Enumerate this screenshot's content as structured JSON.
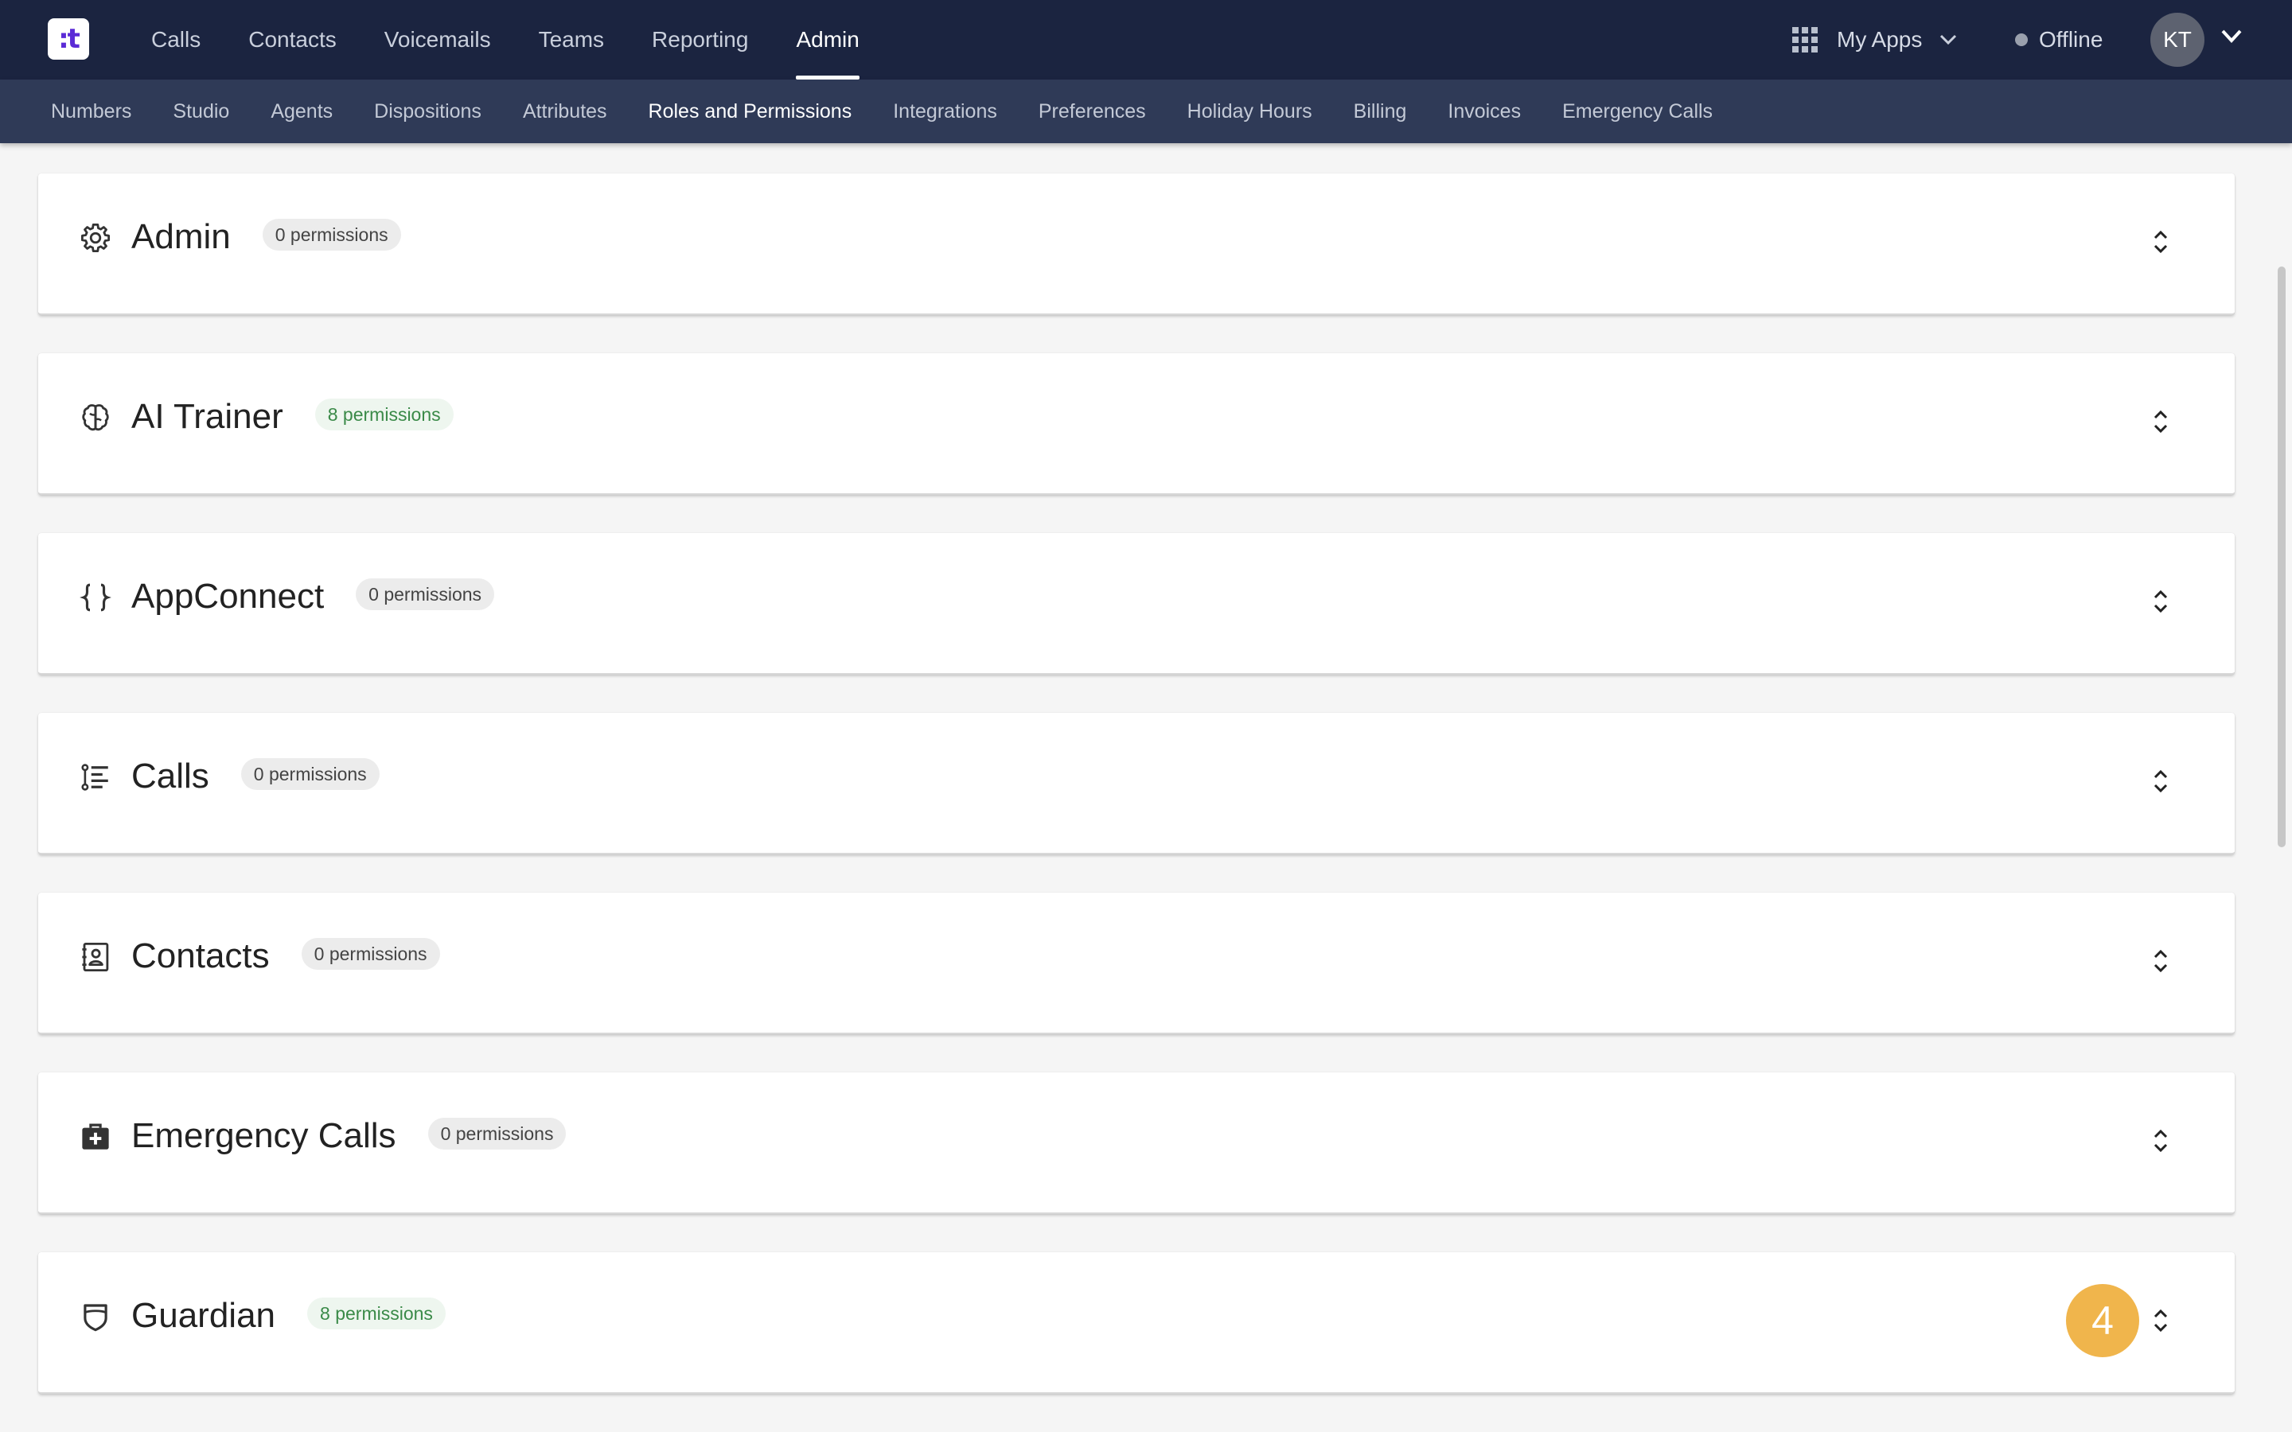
{
  "app": {
    "logo_text": ":t"
  },
  "topnav": {
    "items": [
      {
        "label": "Calls"
      },
      {
        "label": "Contacts"
      },
      {
        "label": "Voicemails"
      },
      {
        "label": "Teams"
      },
      {
        "label": "Reporting"
      },
      {
        "label": "Admin",
        "active": true
      }
    ],
    "my_apps_label": "My Apps",
    "status_label": "Offline",
    "avatar_initials": "KT"
  },
  "subnav": {
    "items": [
      {
        "label": "Numbers"
      },
      {
        "label": "Studio"
      },
      {
        "label": "Agents"
      },
      {
        "label": "Dispositions"
      },
      {
        "label": "Attributes"
      },
      {
        "label": "Roles and Permissions",
        "active": true
      },
      {
        "label": "Integrations"
      },
      {
        "label": "Preferences"
      },
      {
        "label": "Holiday Hours"
      },
      {
        "label": "Billing"
      },
      {
        "label": "Invoices"
      },
      {
        "label": "Emergency Calls"
      }
    ]
  },
  "sections": [
    {
      "title": "Admin",
      "badge": "0 permissions",
      "icon": "gear-icon",
      "badge_tone": "neutral"
    },
    {
      "title": "AI Trainer",
      "badge": "8 permissions",
      "icon": "brain-icon",
      "badge_tone": "green"
    },
    {
      "title": "AppConnect",
      "badge": "0 permissions",
      "icon": "braces-icon",
      "badge_tone": "neutral"
    },
    {
      "title": "Calls",
      "badge": "0 permissions",
      "icon": "list-icon",
      "badge_tone": "neutral"
    },
    {
      "title": "Contacts",
      "badge": "0 permissions",
      "icon": "contact-book-icon",
      "badge_tone": "neutral"
    },
    {
      "title": "Emergency Calls",
      "badge": "0 permissions",
      "icon": "medical-kit-icon",
      "badge_tone": "neutral"
    },
    {
      "title": "Guardian",
      "badge": "8 permissions",
      "icon": "shield-icon",
      "badge_tone": "green"
    }
  ],
  "step_marker": "4",
  "colors": {
    "topbar": "#1b2440",
    "subbar": "#2f3a57",
    "badge_green_text": "#3a8a48",
    "step_marker": "#f0b54c"
  }
}
